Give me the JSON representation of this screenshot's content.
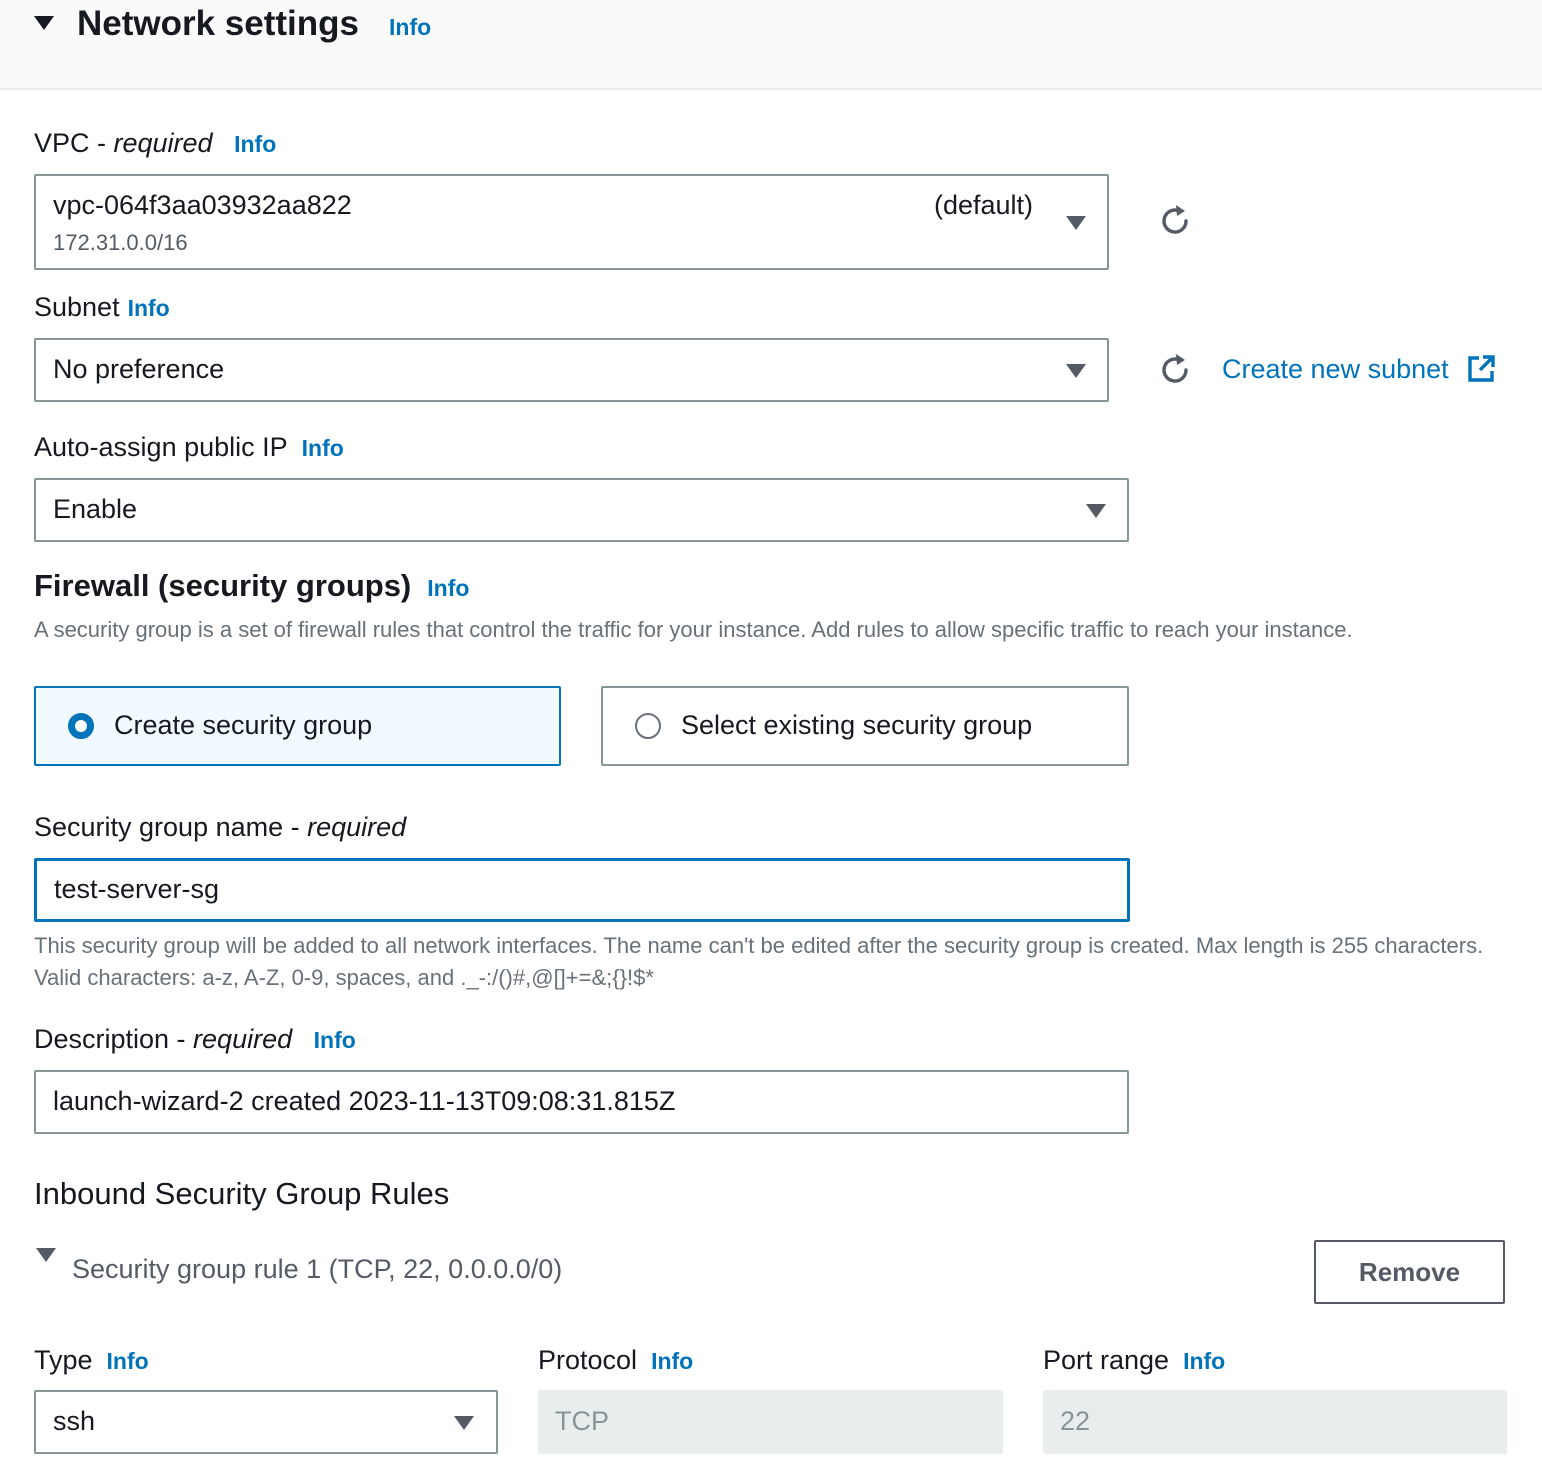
{
  "header": {
    "title": "Network settings",
    "info": "Info"
  },
  "vpc": {
    "label": "VPC - ",
    "required": "required",
    "info": "Info",
    "value": "vpc-064f3aa03932aa822",
    "default_tag": "(default)",
    "cidr": "172.31.0.0/16"
  },
  "subnet": {
    "label": "Subnet",
    "info": "Info",
    "value": "No preference",
    "create_link": "Create new subnet"
  },
  "auto_ip": {
    "label": "Auto-assign public IP",
    "info": "Info",
    "value": "Enable"
  },
  "firewall": {
    "title": "Firewall (security groups)",
    "info": "Info",
    "description": "A security group is a set of firewall rules that control the traffic for your instance. Add rules to allow specific traffic to reach your instance.",
    "option_create": "Create security group",
    "option_existing": "Select existing security group",
    "selected": "create"
  },
  "sg_name": {
    "label": "Security group name - ",
    "required": "required",
    "value": "test-server-sg",
    "hint": "This security group will be added to all network interfaces. The name can't be edited after the security group is created. Max length is 255 characters. Valid characters: a-z, A-Z, 0-9, spaces, and ._-:/()#,@[]+=&;{}!$*"
  },
  "description": {
    "label": "Description - ",
    "required": "required",
    "info": "Info",
    "value": "launch-wizard-2 created 2023-11-13T09:08:31.815Z"
  },
  "inbound": {
    "title": "Inbound Security Group Rules",
    "rule_title": "Security group rule 1 (TCP, 22, 0.0.0.0/0)",
    "remove": "Remove",
    "type": {
      "label": "Type",
      "info": "Info",
      "value": "ssh"
    },
    "protocol": {
      "label": "Protocol",
      "info": "Info",
      "value": "TCP"
    },
    "port_range": {
      "label": "Port range",
      "info": "Info",
      "value": "22"
    }
  },
  "icons": {
    "caret": "caret-down-icon",
    "refresh": "refresh-icon",
    "external": "external-link-icon"
  },
  "colors": {
    "link": "#0073bb",
    "text": "#16191f",
    "border": "#879596",
    "selected_bg": "#f1faff"
  }
}
